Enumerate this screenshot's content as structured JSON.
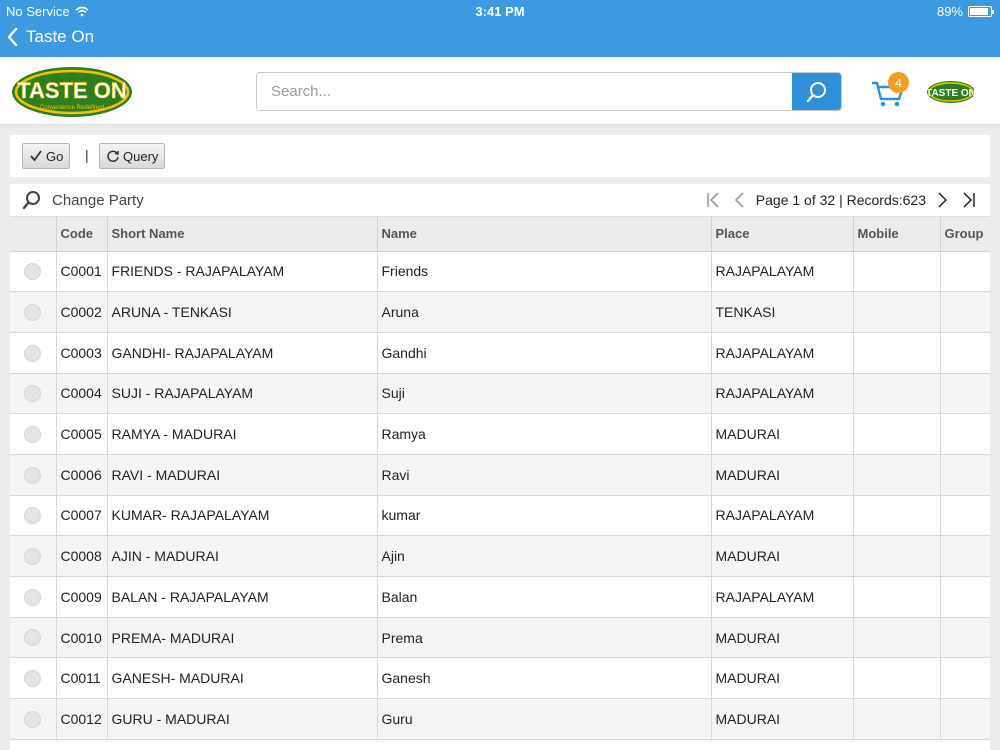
{
  "status_bar": {
    "carrier": "No Service",
    "time": "3:41 PM",
    "battery_pct": "89%",
    "battery_level": 0.89
  },
  "nav": {
    "back_title": "Taste On"
  },
  "header": {
    "logo_text": "TASTE ON",
    "logo_tagline": "Convenience Redefined",
    "search_placeholder": "Search...",
    "cart_count": "4",
    "avatar_text": "TASTE ON"
  },
  "toolbar": {
    "go_label": "Go",
    "separator": "|",
    "query_label": "Query"
  },
  "grid": {
    "change_party_label": "Change Party",
    "pager_text": "Page 1 of 32 | Records:623",
    "columns": [
      "Code",
      "Short Name",
      "Name",
      "Place",
      "Mobile",
      "Group"
    ],
    "rows": [
      {
        "code": "C0001",
        "short_name": "FRIENDS - RAJAPALAYAM",
        "name": "Friends",
        "place": "RAJAPALAYAM",
        "mobile": "",
        "group": ""
      },
      {
        "code": "C0002",
        "short_name": "ARUNA - TENKASI",
        "name": "Aruna",
        "place": "TENKASI",
        "mobile": "",
        "group": ""
      },
      {
        "code": "C0003",
        "short_name": "GANDHI- RAJAPALAYAM",
        "name": "Gandhi",
        "place": "RAJAPALAYAM",
        "mobile": "",
        "group": ""
      },
      {
        "code": "C0004",
        "short_name": "SUJI - RAJAPALAYAM",
        "name": "Suji",
        "place": "RAJAPALAYAM",
        "mobile": "",
        "group": ""
      },
      {
        "code": "C0005",
        "short_name": "RAMYA - MADURAI",
        "name": "Ramya",
        "place": "MADURAI",
        "mobile": "",
        "group": ""
      },
      {
        "code": "C0006",
        "short_name": "RAVI - MADURAI",
        "name": "Ravi",
        "place": "MADURAI",
        "mobile": "",
        "group": ""
      },
      {
        "code": "C0007",
        "short_name": "KUMAR- RAJAPALAYAM",
        "name": "kumar",
        "place": "RAJAPALAYAM",
        "mobile": "",
        "group": ""
      },
      {
        "code": "C0008",
        "short_name": "AJIN - MADURAI",
        "name": "Ajin",
        "place": "MADURAI",
        "mobile": "",
        "group": ""
      },
      {
        "code": "C0009",
        "short_name": "BALAN - RAJAPALAYAM",
        "name": "Balan",
        "place": "RAJAPALAYAM",
        "mobile": "",
        "group": ""
      },
      {
        "code": "C0010",
        "short_name": "PREMA- MADURAI",
        "name": "Prema",
        "place": "MADURAI",
        "mobile": "",
        "group": ""
      },
      {
        "code": "C0011",
        "short_name": "GANESH- MADURAI",
        "name": "Ganesh",
        "place": "MADURAI",
        "mobile": "",
        "group": ""
      },
      {
        "code": "C0012",
        "short_name": "GURU - MADURAI",
        "name": "Guru",
        "place": "MADURAI",
        "mobile": "",
        "group": ""
      }
    ]
  },
  "colors": {
    "accent": "#3d9ae0",
    "search_button": "#2f8fd8",
    "badge": "#f39c27",
    "logo_green": "#2e7d1e",
    "logo_yellow": "#f2c400"
  },
  "icons": [
    "wifi-icon",
    "battery-icon",
    "back-chevron-icon",
    "search-icon",
    "cart-icon",
    "checkmark-icon",
    "refresh-icon",
    "magnifier-icon",
    "first-page-icon",
    "prev-page-icon",
    "next-page-icon",
    "last-page-icon"
  ]
}
